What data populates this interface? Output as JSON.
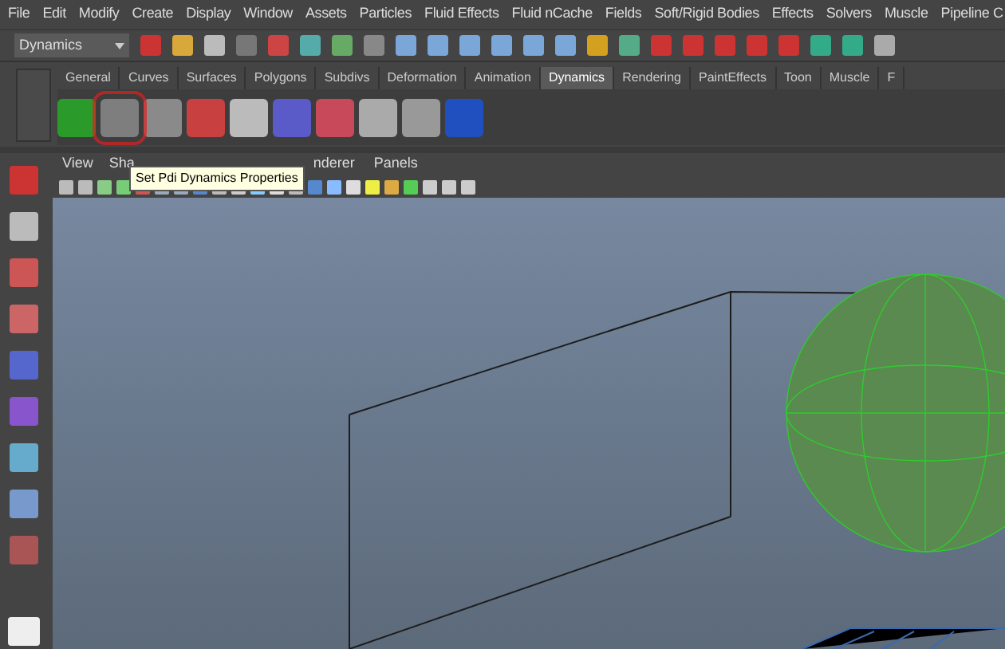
{
  "menu_bar": [
    "File",
    "Edit",
    "Modify",
    "Create",
    "Display",
    "Window",
    "Assets",
    "Particles",
    "Fluid Effects",
    "Fluid nCache",
    "Fields",
    "Soft/Rigid Bodies",
    "Effects",
    "Solvers",
    "Muscle",
    "Pipeline C"
  ],
  "mode_dropdown": {
    "value": "Dynamics"
  },
  "shelf_tabs": [
    {
      "label": "General",
      "selected": false
    },
    {
      "label": "Curves",
      "selected": false
    },
    {
      "label": "Surfaces",
      "selected": false
    },
    {
      "label": "Polygons",
      "selected": false
    },
    {
      "label": "Subdivs",
      "selected": false
    },
    {
      "label": "Deformation",
      "selected": false
    },
    {
      "label": "Animation",
      "selected": false
    },
    {
      "label": "Dynamics",
      "selected": true
    },
    {
      "label": "Rendering",
      "selected": false
    },
    {
      "label": "PaintEffects",
      "selected": false
    },
    {
      "label": "Toon",
      "selected": false
    },
    {
      "label": "Muscle",
      "selected": false
    },
    {
      "label": "F",
      "selected": false
    }
  ],
  "shelf_items": [
    {
      "selected": false
    },
    {
      "selected": true
    },
    {
      "selected": false
    },
    {
      "selected": false
    },
    {
      "selected": false
    },
    {
      "selected": false
    },
    {
      "selected": false
    },
    {
      "selected": false
    },
    {
      "selected": false
    },
    {
      "selected": false
    }
  ],
  "tooltip": "Set Pdi Dynamics Properties",
  "panel_menu": [
    "View",
    "Sha",
    "nderer",
    "Panels"
  ]
}
